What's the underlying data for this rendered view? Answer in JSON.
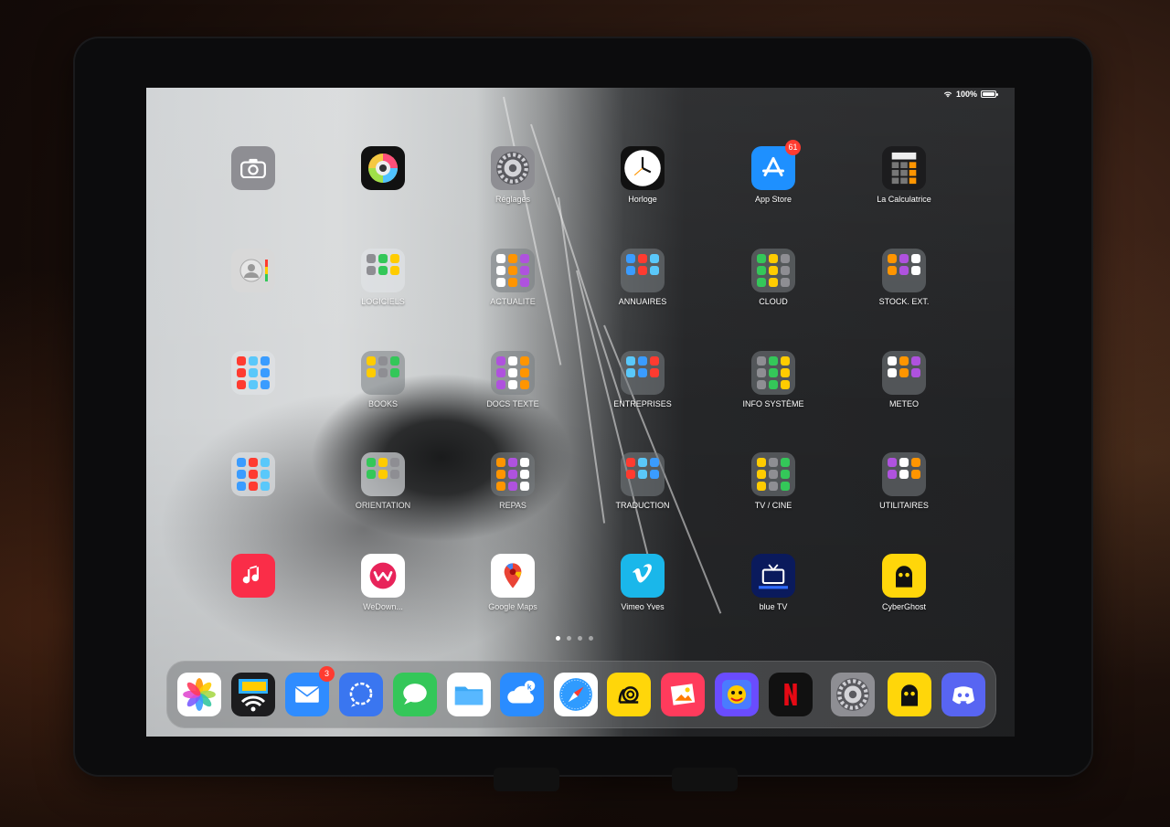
{
  "status_bar": {
    "battery": "100%"
  },
  "apps": [
    {
      "label": "",
      "icon": "camera-icon",
      "color": "#8e8e93"
    },
    {
      "label": "",
      "icon": "halide-lens-icon",
      "color": "#111111"
    },
    {
      "label": "Réglages",
      "icon": "settings-gear-icon",
      "color": "#8e8e93"
    },
    {
      "label": "Horloge",
      "icon": "clock-icon",
      "color": "#111111"
    },
    {
      "label": "App Store",
      "icon": "app-store-icon",
      "color": "#1e90ff",
      "badge": "61"
    },
    {
      "label": "La Calculatrice",
      "icon": "calculator-icon",
      "color": "#1c1c1e"
    },
    {
      "label": "",
      "icon": "contacts-icon",
      "color": "#d8d8d8"
    },
    {
      "label": "LOGICIELS",
      "icon": "folder-icon",
      "color": "#e8e8e8"
    },
    {
      "label": "ACTUALITE",
      "icon": "folder-icon",
      "color": "#888888"
    },
    {
      "label": "ANNUAIRES",
      "icon": "folder-icon",
      "color": "#888888"
    },
    {
      "label": "CLOUD",
      "icon": "folder-icon",
      "color": "#888888"
    },
    {
      "label": "STOCK. EXT.",
      "icon": "folder-icon",
      "color": "#888888"
    },
    {
      "label": "",
      "icon": "folder-icon",
      "color": "#e8e8e8"
    },
    {
      "label": "BOOKS",
      "icon": "folder-icon",
      "color": "#555555"
    },
    {
      "label": "DOCS TEXTE",
      "icon": "folder-icon",
      "color": "#888888"
    },
    {
      "label": "ENTREPRISES",
      "icon": "folder-icon",
      "color": "#888888"
    },
    {
      "label": "INFO SYSTÈME",
      "icon": "folder-icon",
      "color": "#888888"
    },
    {
      "label": "METEO",
      "icon": "folder-icon",
      "color": "#888888"
    },
    {
      "label": "",
      "icon": "folder-icon",
      "color": "#e8e8e8"
    },
    {
      "label": "ORIENTATION",
      "icon": "folder-icon",
      "color": "#bbbbbb"
    },
    {
      "label": "REPAS",
      "icon": "folder-icon",
      "color": "#888888"
    },
    {
      "label": "TRADUCTION",
      "icon": "folder-icon",
      "color": "#888888"
    },
    {
      "label": "TV / CINE",
      "icon": "folder-icon",
      "color": "#888888"
    },
    {
      "label": "UTILITAIRES",
      "icon": "folder-icon",
      "color": "#888888"
    },
    {
      "label": "",
      "icon": "music-icon",
      "color": "#fa2d48"
    },
    {
      "label": "WeDown...",
      "icon": "wedownload-icon",
      "color": "#ffffff"
    },
    {
      "label": "Google Maps",
      "icon": "google-maps-icon",
      "color": "#ffffff"
    },
    {
      "label": "Vimeo Yves",
      "icon": "vimeo-icon",
      "color": "#1ab7ea"
    },
    {
      "label": "blue TV",
      "icon": "tv-icon",
      "color": "#0a1a5c"
    },
    {
      "label": "CyberGhost",
      "icon": "cyberghost-icon",
      "color": "#ffd60a"
    }
  ],
  "dock": [
    {
      "icon": "photos-icon",
      "color": "#ffffff"
    },
    {
      "icon": "wifi-transfer-icon",
      "color": "#1c1c1e"
    },
    {
      "icon": "mail-icon",
      "color": "#2f8cff",
      "badge": "3"
    },
    {
      "icon": "signal-icon",
      "color": "#3a76f0"
    },
    {
      "icon": "messages-icon",
      "color": "#34c759"
    },
    {
      "icon": "files-icon",
      "color": "#ffffff"
    },
    {
      "icon": "keynote-cloud-icon",
      "color": "#2a8cff"
    },
    {
      "icon": "safari-icon",
      "color": "#ffffff"
    },
    {
      "icon": "snail-icon",
      "color": "#ffd60a"
    },
    {
      "icon": "photo-edit-icon",
      "color": "#ff3b5c"
    },
    {
      "icon": "puzzle-game-icon",
      "color": "#6a4cff"
    },
    {
      "icon": "netflix-icon",
      "color": "#111111"
    },
    {
      "icon": "settings-gear-icon",
      "color": "#8e8e93"
    },
    {
      "icon": "cyberghost-icon",
      "color": "#ffd60a"
    },
    {
      "icon": "discord-icon",
      "color": "#5865f2"
    }
  ],
  "page_dots": 4
}
